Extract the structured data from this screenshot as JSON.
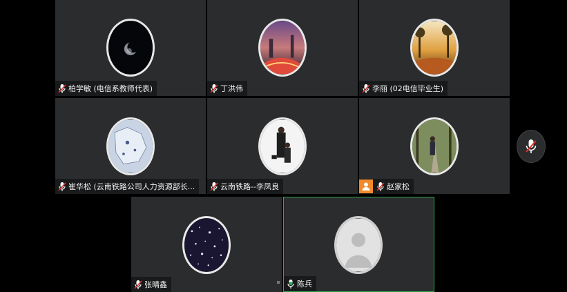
{
  "participants": [
    {
      "name": "柏学敏 (电信系教师代表)",
      "mic": "muted"
    },
    {
      "name": "丁洪伟",
      "mic": "muted"
    },
    {
      "name": "李丽 (02电信毕业生)",
      "mic": "muted"
    },
    {
      "name": "崔华松 (云南铁路公司人力资源部长...",
      "mic": "muted"
    },
    {
      "name": "云南铁路--李凤良",
      "mic": "muted"
    },
    {
      "name": "赵家松",
      "mic": "muted",
      "host": true
    },
    {
      "name": "张晴鑫",
      "mic": "muted"
    },
    {
      "name": "陈兵",
      "mic": "active"
    }
  ],
  "colors": {
    "tile_bg": "#2b2c2e",
    "active_border": "#2fa84f",
    "mute_red": "#e0302a",
    "host_orange": "#f08a2c"
  },
  "icons": {
    "mic_muted": "mic-muted-icon",
    "mic_active": "mic-active-icon",
    "host": "host-person-icon"
  }
}
